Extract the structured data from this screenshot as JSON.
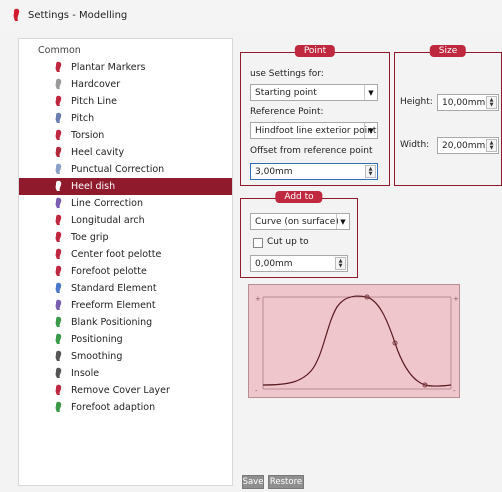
{
  "window": {
    "title": "Settings - Modelling"
  },
  "tree": {
    "root": "Common",
    "items": [
      {
        "label": "Plantar Markers",
        "icon": "marker-icon",
        "color": "#c0283f"
      },
      {
        "label": "Hardcover",
        "icon": "hardcover-icon",
        "color": "#9a9a9a"
      },
      {
        "label": "Pitch Line",
        "icon": "pitch-line-icon",
        "color": "#c0283f"
      },
      {
        "label": "Pitch",
        "icon": "pitch-icon",
        "color": "#6a7fb0"
      },
      {
        "label": "Torsion",
        "icon": "torsion-icon",
        "color": "#c0283f"
      },
      {
        "label": "Heel cavity",
        "icon": "heel-cavity-icon",
        "color": "#b22a3c"
      },
      {
        "label": "Punctual Correction",
        "icon": "punctual-correction-icon",
        "color": "#8aa0c8"
      },
      {
        "label": "Heel dish",
        "icon": "heel-dish-icon",
        "color": "#ffffff",
        "selected": true
      },
      {
        "label": "Line Correction",
        "icon": "line-correction-icon",
        "color": "#7a5fb0"
      },
      {
        "label": "Longitudal arch",
        "icon": "longitudal-arch-icon",
        "color": "#c0283f"
      },
      {
        "label": "Toe grip",
        "icon": "toe-grip-icon",
        "color": "#c0283f"
      },
      {
        "label": "Center foot pelotte",
        "icon": "center-foot-pelotte-icon",
        "color": "#c0283f"
      },
      {
        "label": "Forefoot pelotte",
        "icon": "forefoot-pelotte-icon",
        "color": "#c0283f"
      },
      {
        "label": "Standard Element",
        "icon": "standard-element-icon",
        "color": "#4b78c8"
      },
      {
        "label": "Freeform Element",
        "icon": "freeform-element-icon",
        "color": "#7a5fb0"
      },
      {
        "label": "Blank Positioning",
        "icon": "blank-positioning-icon",
        "color": "#3a9a4a"
      },
      {
        "label": "Positioning",
        "icon": "positioning-icon",
        "color": "#3a9a4a"
      },
      {
        "label": "Smoothing",
        "icon": "smoothing-icon",
        "color": "#555555"
      },
      {
        "label": "Insole",
        "icon": "insole-icon",
        "color": "#555555"
      },
      {
        "label": "Remove Cover Layer",
        "icon": "remove-cover-layer-icon",
        "color": "#c0283f"
      },
      {
        "label": "Forefoot adaption",
        "icon": "forefoot-adaption-icon",
        "color": "#3a9a4a"
      }
    ]
  },
  "point_group": {
    "title": "Point",
    "use_settings_label": "use Settings for:",
    "use_settings_value": "Starting point",
    "reference_label": "Reference Point:",
    "reference_value": "Hindfoot line exterior point",
    "offset_label": "Offset from reference point",
    "offset_value": "3,00mm"
  },
  "size_group": {
    "title": "Size",
    "height_label": "Height:",
    "height_value": "10,00mm",
    "width_label": "Width:",
    "width_value": "20,00mm"
  },
  "add_group": {
    "title": "Add to",
    "mode_value": "Curve (on surface)",
    "cut_label": "Cut up to",
    "cut_checked": false,
    "cut_value": "0,00mm"
  },
  "buttons": {
    "save": "Save",
    "restore": "Restore"
  },
  "colors": {
    "accent": "#8e1a2c",
    "group_title": "#c0283f",
    "preview_bg": "#efc6cc"
  }
}
